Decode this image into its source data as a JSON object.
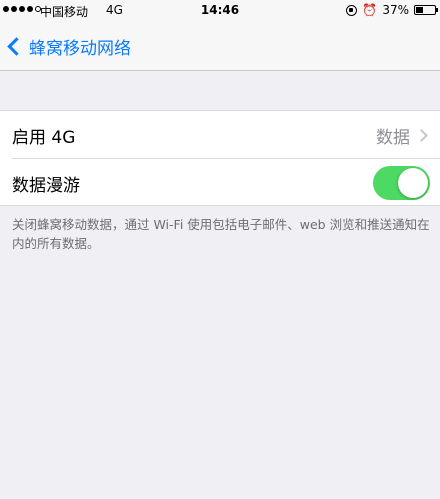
{
  "status_bar": {
    "carrier": "中国移动",
    "network": "4G",
    "time": "14:46",
    "battery_percent": "37%",
    "battery_level": 0.37,
    "signal_bars": 4,
    "signal_total": 5,
    "icons": [
      "signal-dots-icon",
      "rotation-lock-icon",
      "alarm-icon",
      "battery-icon"
    ]
  },
  "nav": {
    "back_icon": "chevron-left-icon",
    "title": "蜂窝移动网络"
  },
  "settings": {
    "rows": [
      {
        "label": "启用 4G",
        "value": "数据",
        "accessory": "chevron-right-icon"
      },
      {
        "label": "数据漫游",
        "toggle_on": true
      }
    ]
  },
  "footnote": "关闭蜂窝移动数据，通过 Wi-Fi 使用包括电子邮件、web 浏览和推送通知在内的所有数据。",
  "colors": {
    "accent": "#0a7aff",
    "toggle_on": "#4cd964",
    "background": "#efeff4",
    "secondary_text": "#8e8e93"
  }
}
